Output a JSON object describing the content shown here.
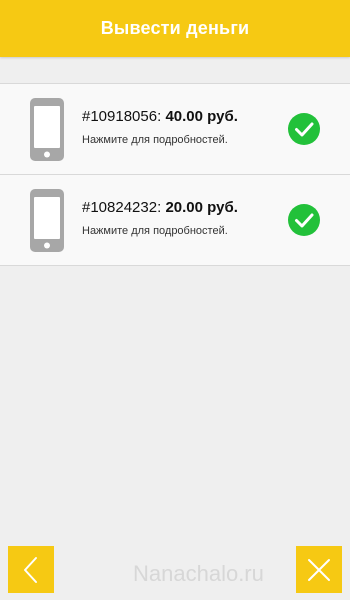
{
  "header": {
    "title": "Вывести деньги"
  },
  "transactions": [
    {
      "id": "#10918056",
      "separator": ": ",
      "amount": "40.00 руб.",
      "hint": "Нажмите для подробностей.",
      "icon": "phone-icon",
      "status_icon": "check-circle-icon"
    },
    {
      "id": "#10824232",
      "separator": ": ",
      "amount": "20.00 руб.",
      "hint": "Нажмите для подробностей.",
      "icon": "phone-icon",
      "status_icon": "check-circle-icon"
    }
  ],
  "footer": {
    "back_icon": "chevron-left-icon",
    "close_icon": "close-icon",
    "watermark": "Nanachalo.ru"
  },
  "colors": {
    "accent": "#f6c913",
    "success": "#22c13a",
    "background": "#efefef",
    "icon_gray": "#a7a7a7"
  }
}
